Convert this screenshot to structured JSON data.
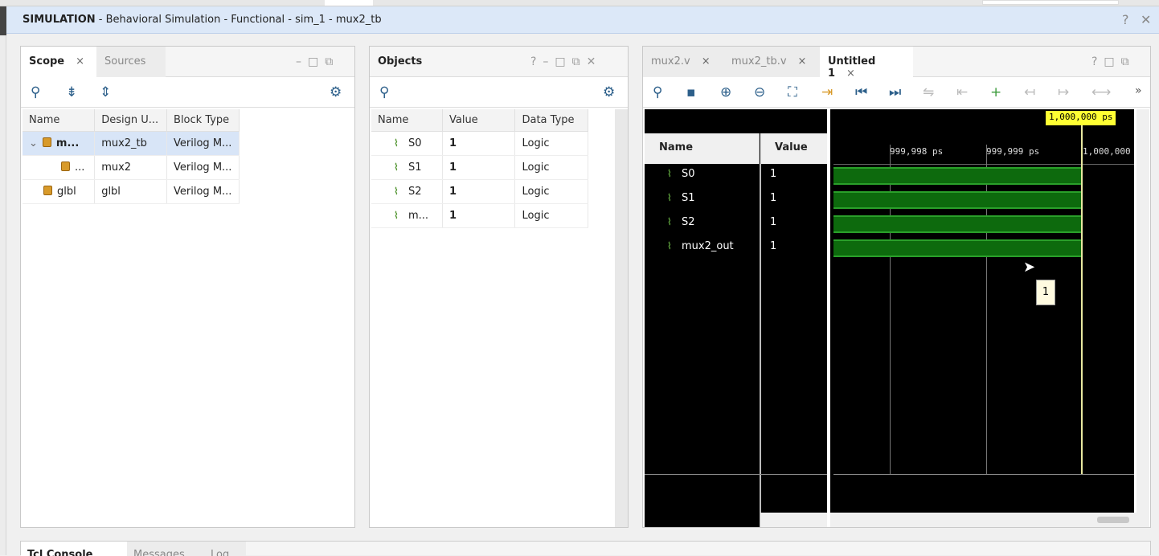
{
  "window": {
    "mode": "SIMULATION",
    "title_rest": " - Behavioral Simulation - Functional - sim_1 - mux2_tb",
    "help": "?",
    "close": "✕"
  },
  "scope_panel": {
    "tabs": [
      {
        "label": "Scope",
        "close": "×"
      },
      {
        "label": "Sources"
      }
    ],
    "columns": [
      "Name",
      "Design U...",
      "Block Type"
    ],
    "rows": [
      {
        "expander": "⌄",
        "name": "m...",
        "design_unit": "mux2_tb",
        "block_type": "Verilog M..."
      },
      {
        "name": "...",
        "design_unit": "mux2",
        "block_type": "Verilog M..."
      },
      {
        "name": "glbl",
        "design_unit": "glbl",
        "block_type": "Verilog M..."
      }
    ]
  },
  "objects_panel": {
    "title": "Objects",
    "columns": [
      "Name",
      "Value",
      "Data Type"
    ],
    "rows": [
      {
        "name": "S0",
        "value": "1",
        "type": "Logic"
      },
      {
        "name": "S1",
        "value": "1",
        "type": "Logic"
      },
      {
        "name": "S2",
        "value": "1",
        "type": "Logic"
      },
      {
        "name": "m...",
        "value": "1",
        "type": "Logic"
      }
    ]
  },
  "wave_panel": {
    "tabs": [
      {
        "label": "mux2.v",
        "close": "×"
      },
      {
        "label": "mux2_tb.v",
        "close": "×"
      },
      {
        "label": "Untitled 1",
        "close": "×"
      }
    ],
    "name_header": "Name",
    "value_header": "Value",
    "cursor_label": "1,000,000 ps",
    "ticks": [
      "999,998 ps",
      "999,999 ps",
      "1,000,000"
    ],
    "signals": [
      {
        "name": "S0",
        "value": "1"
      },
      {
        "name": "S1",
        "value": "1"
      },
      {
        "name": "S2",
        "value": "1"
      },
      {
        "name": "mux2_out",
        "value": "1"
      }
    ],
    "tooltip": "1",
    "more": "»"
  },
  "bottom_tabs": [
    "Tcl Console",
    "Messages",
    "Log"
  ],
  "colors": {
    "wave_green": "#0d6a0d",
    "cursor_yellow": "#ffff33",
    "title_bg": "#dce8f8"
  }
}
